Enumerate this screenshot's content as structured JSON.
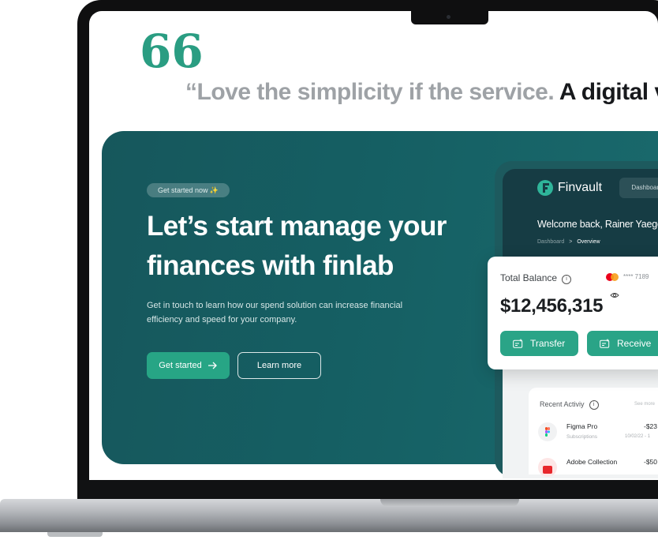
{
  "testimonial": {
    "quote_mark": "66",
    "text_light": "“Love the simplicity if the service.",
    "text_dark": "A digital v"
  },
  "hero": {
    "badge": "Get started now",
    "headline_line1": "Let’s start manage your",
    "headline_line2": "finances with finlab",
    "subtext_line1": "Get in touch to learn how our spend solution can increase financial",
    "subtext_line2": "efficiency and speed for your company.",
    "primary_button": "Get started",
    "secondary_button": "Learn more"
  },
  "dashboard": {
    "brand": "Finvault",
    "nav_tab": "Dashboard",
    "welcome": "Welcome back, Rainer Yaege",
    "breadcrumb": {
      "root": "Dashboard",
      "separator": ">",
      "current": "Overview"
    },
    "balance": {
      "label": "Total Balance",
      "card_number": "**** 7189",
      "amount": "$12,456,315",
      "transfer_label": "Transfer",
      "receive_label": "Receive"
    },
    "activity": {
      "title": "Recent Activiy",
      "see_more": "See more",
      "rows": [
        {
          "name": "Figma Pro",
          "category": "Subscriptions",
          "amount": "-$23",
          "date": "10/02/22 - 1"
        },
        {
          "name": "Adobe Collection",
          "category": "",
          "amount": "-$50",
          "date": ""
        }
      ]
    }
  },
  "colors": {
    "accent": "#27a585",
    "hero_bg": "#155f63",
    "dashboard_dark": "#163c44",
    "quote_mark": "#2a9d82"
  }
}
